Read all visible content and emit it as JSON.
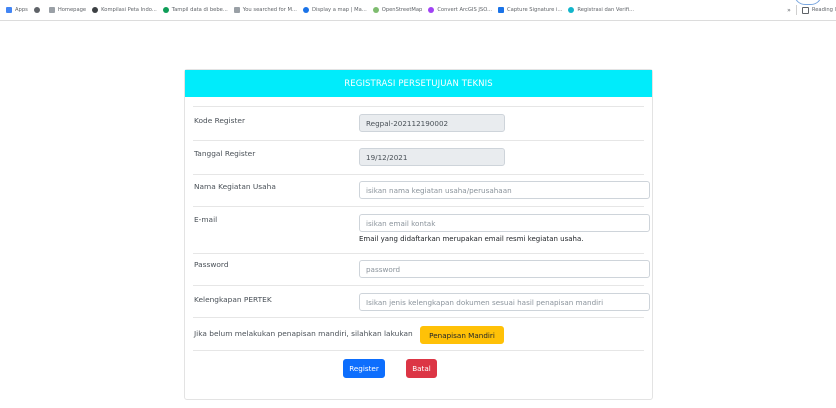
{
  "bookmarks_bar": {
    "items": [
      {
        "label": "Apps",
        "icon": "apps-grid-icon",
        "color": "#4285f4"
      },
      {
        "label": "",
        "icon": "globe-icon",
        "color": "#5f6368"
      },
      {
        "label": "Homepage",
        "icon": "grid-icon",
        "color": "#5f6368"
      },
      {
        "label": "Kompilasi Peta Indo...",
        "icon": "bookmark-dark-icon",
        "color": "#3c4043"
      },
      {
        "label": "Tampil data di bebe...",
        "icon": "bookmark-green-icon",
        "color": "#0f9d58"
      },
      {
        "label": "You searched for M...",
        "icon": "bookmark-code-icon",
        "color": "#5f6368"
      },
      {
        "label": "Display a map | Ma...",
        "icon": "bookmark-blue-icon",
        "color": "#1a73e8"
      },
      {
        "label": "OpenStreetMap",
        "icon": "osm-icon",
        "color": "#7ebc6f"
      },
      {
        "label": "Convert ArcGIS JSO...",
        "icon": "pin-icon",
        "color": "#a142f4"
      },
      {
        "label": "Capture Signature i...",
        "icon": "bookmark-m-icon",
        "color": "#1a73e8"
      },
      {
        "label": "Registrasi dan Verifi...",
        "icon": "bookmark-teal-icon",
        "color": "#12b5cb"
      }
    ],
    "overflow": "»",
    "reading_list": "Reading l"
  },
  "form": {
    "title": "REGISTRASI PERSETUJUAN TEKNIS",
    "kode_register": {
      "label": "Kode Register",
      "value": "Regpal-202112190002"
    },
    "tanggal_register": {
      "label": "Tanggal Register",
      "value": "19/12/2021"
    },
    "nama_kegiatan": {
      "label": "Nama Kegiatan Usaha",
      "placeholder": "isikan nama kegiatan usaha/perusahaan"
    },
    "email": {
      "label": "E-mail",
      "placeholder": "isikan email kontak",
      "help": "Email yang didaftarkan merupakan email resmi kegiatan usaha."
    },
    "password": {
      "label": "Password",
      "placeholder": "password"
    },
    "kelengkapan": {
      "label": "Kelengkapan PERTEK",
      "placeholder": "Isikan jenis kelengkapan dokumen sesuai hasil penapisan mandiri"
    },
    "penapisan_text": "Jika belum melakukan penapisan mandiri, silahkan lakukan",
    "penapisan_button": "Penapisan Mandiri",
    "register_button": "Register",
    "batal_button": "Batal"
  },
  "colors": {
    "header": "#00ecfb",
    "primary": "#0d6efd",
    "danger": "#dc3545",
    "warning": "#ffc107"
  }
}
